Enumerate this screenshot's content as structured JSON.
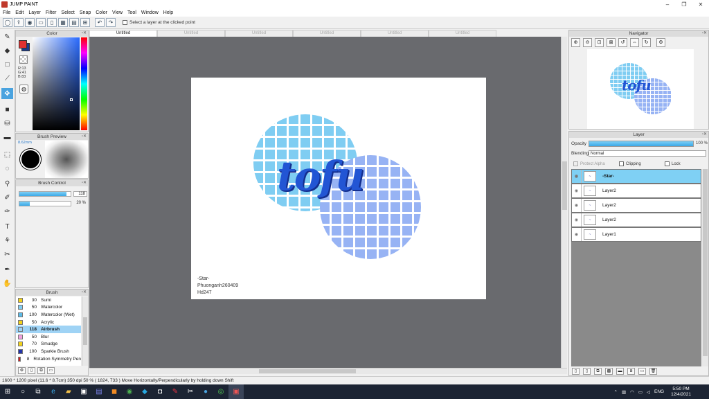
{
  "window": {
    "title": "JUMP PAINT",
    "min": "–",
    "max": "❐",
    "close": "✕"
  },
  "menu": [
    "File",
    "Edit",
    "Layer",
    "Filter",
    "Select",
    "Snap",
    "Color",
    "View",
    "Tool",
    "Window",
    "Help"
  ],
  "toolbar": {
    "select_layer_label": "Select a layer at the clicked point"
  },
  "color_panel": {
    "title": "Color",
    "r": "R:13",
    "g": "G:41",
    "b": "B:83",
    "main_color": "#e03030",
    "sub_color": "#1a3b8f"
  },
  "brush_preview": {
    "title": "Brush Preview",
    "size": "8.62mm"
  },
  "brush_control": {
    "title": "Brush Control",
    "size_value": "118",
    "size_percent": 92,
    "density_value": "20 %",
    "density_percent": 20
  },
  "brush_panel": {
    "title": "Brush",
    "items": [
      {
        "num": "30",
        "name": "Sumi",
        "color": "#f2d21a"
      },
      {
        "num": "50",
        "name": "Watercolor",
        "color": "#7fcdf2"
      },
      {
        "num": "100",
        "name": "Watercolor (Wet)",
        "color": "#5bbbe8"
      },
      {
        "num": "50",
        "name": "Acrylic",
        "color": "#f2d21a"
      },
      {
        "num": "118",
        "name": "Airbrush",
        "color": "#9fd3f5"
      },
      {
        "num": "50",
        "name": "Blur",
        "color": "#f0a0e0"
      },
      {
        "num": "70",
        "name": "Smudge",
        "color": "#f2d21a"
      },
      {
        "num": "100",
        "name": "Sparkle Brush",
        "color": "#2233aa"
      },
      {
        "num": "8",
        "name": "Rotation Symmetry Pen",
        "color": "#d02020"
      }
    ]
  },
  "tabs": [
    "Untitled",
    "Untitled",
    "Untitled",
    "Untitled",
    "Untitled",
    "Untitled"
  ],
  "canvas": {
    "artwork_text": "tofu",
    "signature": [
      "-Star-",
      "Phuonganh260409",
      "Hd247"
    ],
    "colors": {
      "circle_a": "#7fcdf2",
      "circle_b": "#97b3f4",
      "text": "#2255d4"
    }
  },
  "navigator": {
    "title": "Navigator"
  },
  "layer_panel": {
    "title": "Layer",
    "opacity_label": "Opacity",
    "opacity_value": "100 %",
    "opacity_percent": 100,
    "blending_label": "Blending",
    "blending_value": "Normal",
    "protect_alpha": "Protect Alpha",
    "clipping": "Clipping",
    "lock": "Lock",
    "layers": [
      {
        "name": "-Star-",
        "selected": true
      },
      {
        "name": "Layer2",
        "selected": false
      },
      {
        "name": "Layer2",
        "selected": false
      },
      {
        "name": "Layer2",
        "selected": false
      },
      {
        "name": "Layer1",
        "selected": false
      }
    ]
  },
  "status": {
    "text": "1600 * 1200 pixel   (11.6 * 8.7cm)   350 dpi   50 %   ( 1824, 733 )   Move Horizontally/Perpendicularly by holding down Shift"
  },
  "tray": {
    "lang": "ENG",
    "time": "5:50 PM",
    "date": "12/4/2021"
  }
}
